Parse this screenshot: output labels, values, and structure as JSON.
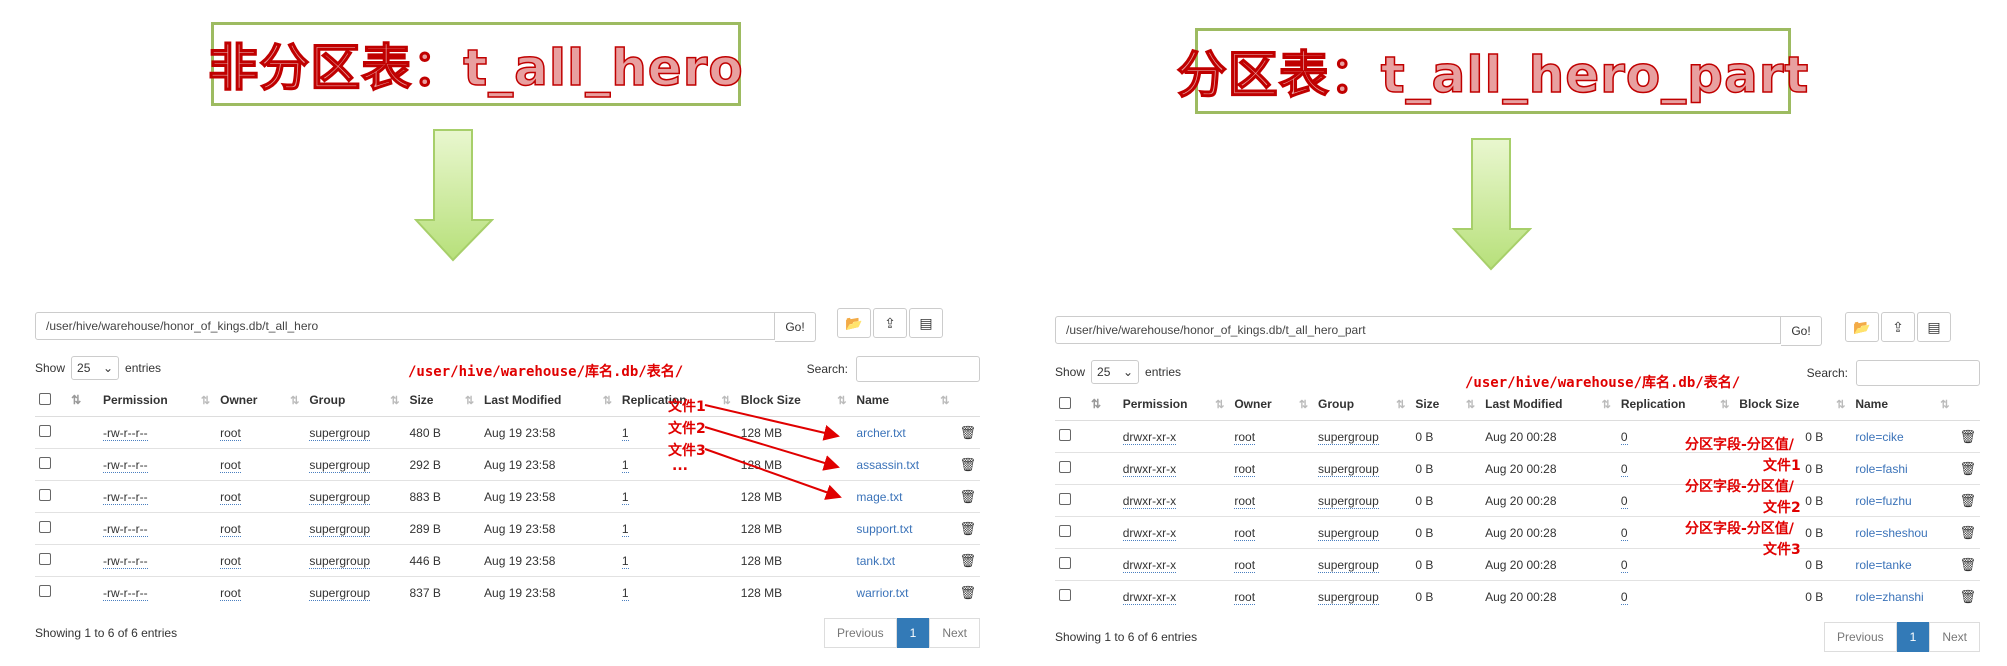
{
  "left": {
    "title": "非分区表：t_all_hero",
    "path": "/user/hive/warehouse/honor_of_kings.db/t_all_hero",
    "go_label": "Go!",
    "show_label": "Show",
    "entries_value": "25",
    "entries_label": "entries",
    "search_label": "Search:",
    "path_annotation": "/user/hive/warehouse/库名.db/表名/",
    "columns": [
      "Permission",
      "Owner",
      "Group",
      "Size",
      "Last Modified",
      "Replication",
      "Block Size",
      "Name"
    ],
    "rows": [
      {
        "perm": "-rw-r--r--",
        "owner": "root",
        "group": "supergroup",
        "size": "480 B",
        "modified": "Aug 19 23:58",
        "rep": "1",
        "block": "128 MB",
        "name": "archer.txt"
      },
      {
        "perm": "-rw-r--r--",
        "owner": "root",
        "group": "supergroup",
        "size": "292 B",
        "modified": "Aug 19 23:58",
        "rep": "1",
        "block": "128 MB",
        "name": "assassin.txt"
      },
      {
        "perm": "-rw-r--r--",
        "owner": "root",
        "group": "supergroup",
        "size": "883 B",
        "modified": "Aug 19 23:58",
        "rep": "1",
        "block": "128 MB",
        "name": "mage.txt"
      },
      {
        "perm": "-rw-r--r--",
        "owner": "root",
        "group": "supergroup",
        "size": "289 B",
        "modified": "Aug 19 23:58",
        "rep": "1",
        "block": "128 MB",
        "name": "support.txt"
      },
      {
        "perm": "-rw-r--r--",
        "owner": "root",
        "group": "supergroup",
        "size": "446 B",
        "modified": "Aug 19 23:58",
        "rep": "1",
        "block": "128 MB",
        "name": "tank.txt"
      },
      {
        "perm": "-rw-r--r--",
        "owner": "root",
        "group": "supergroup",
        "size": "837 B",
        "modified": "Aug 19 23:58",
        "rep": "1",
        "block": "128 MB",
        "name": "warrior.txt"
      }
    ],
    "file_labels": [
      "文件1",
      "文件2",
      "文件3",
      "..."
    ],
    "footer": "Showing 1 to 6 of 6 entries",
    "prev_label": "Previous",
    "page_num": "1",
    "next_label": "Next"
  },
  "right": {
    "title": "分区表：t_all_hero_part",
    "path": "/user/hive/warehouse/honor_of_kings.db/t_all_hero_part",
    "go_label": "Go!",
    "show_label": "Show",
    "entries_value": "25",
    "entries_label": "entries",
    "search_label": "Search:",
    "path_annotation": "/user/hive/warehouse/库名.db/表名/",
    "columns": [
      "Permission",
      "Owner",
      "Group",
      "Size",
      "Last Modified",
      "Replication",
      "Block Size",
      "Name"
    ],
    "rows": [
      {
        "perm": "drwxr-xr-x",
        "owner": "root",
        "group": "supergroup",
        "size": "0 B",
        "modified": "Aug 20 00:28",
        "rep": "0",
        "block": "0 B",
        "name": "role=cike"
      },
      {
        "perm": "drwxr-xr-x",
        "owner": "root",
        "group": "supergroup",
        "size": "0 B",
        "modified": "Aug 20 00:28",
        "rep": "0",
        "block": "0 B",
        "name": "role=fashi"
      },
      {
        "perm": "drwxr-xr-x",
        "owner": "root",
        "group": "supergroup",
        "size": "0 B",
        "modified": "Aug 20 00:28",
        "rep": "0",
        "block": "0 B",
        "name": "role=fuzhu"
      },
      {
        "perm": "drwxr-xr-x",
        "owner": "root",
        "group": "supergroup",
        "size": "0 B",
        "modified": "Aug 20 00:28",
        "rep": "0",
        "block": "0 B",
        "name": "role=sheshou"
      },
      {
        "perm": "drwxr-xr-x",
        "owner": "root",
        "group": "supergroup",
        "size": "0 B",
        "modified": "Aug 20 00:28",
        "rep": "0",
        "block": "0 B",
        "name": "role=tanke"
      },
      {
        "perm": "drwxr-xr-x",
        "owner": "root",
        "group": "supergroup",
        "size": "0 B",
        "modified": "Aug 20 00:28",
        "rep": "0",
        "block": "0 B",
        "name": "role=zhanshi"
      }
    ],
    "partition_annotations": [
      {
        "line1": "分区字段-分区值/",
        "line2": "文件1"
      },
      {
        "line1": "分区字段-分区值/",
        "line2": "文件2"
      },
      {
        "line1": "分区字段-分区值/",
        "line2": "文件3"
      }
    ],
    "footer": "Showing 1 to 6 of 6 entries",
    "prev_label": "Previous",
    "page_num": "1",
    "next_label": "Next"
  },
  "colors": {
    "accent_red": "#e00000",
    "link_blue": "#3b73b9",
    "arrow_green": "#b7e07a",
    "box_border": "#9dbb61"
  },
  "icons": [
    "folder-open-icon",
    "upload-icon",
    "table-icon",
    "trash-icon",
    "sort-icon",
    "checkbox-icon",
    "chevron-down-icon"
  ]
}
